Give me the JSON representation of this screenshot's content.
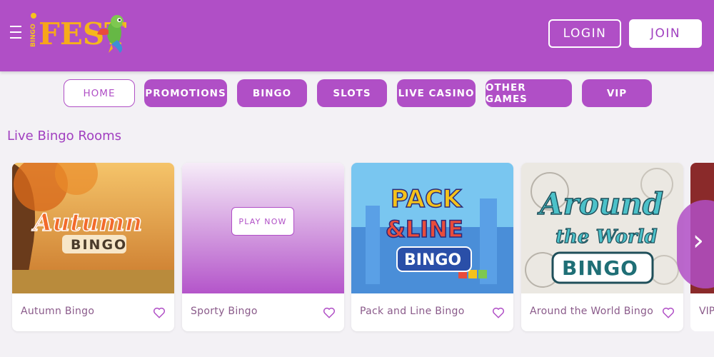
{
  "header": {
    "logo_small": "BINGO",
    "logo_text": "FEST",
    "login_label": "LOGIN",
    "join_label": "JOIN"
  },
  "nav": {
    "items": [
      {
        "label": "HOME",
        "active": true
      },
      {
        "label": "PROMOTIONS",
        "active": false
      },
      {
        "label": "BINGO",
        "active": false
      },
      {
        "label": "SLOTS",
        "active": false
      },
      {
        "label": "LIVE CASINO",
        "active": false
      },
      {
        "label": "OTHER GAMES",
        "active": false
      },
      {
        "label": "VIP",
        "active": false
      }
    ]
  },
  "section": {
    "title": "Live Bingo Rooms"
  },
  "rooms": [
    {
      "name": "Autumn Bingo",
      "art_title": "Autumn",
      "art_sub": "BINGO"
    },
    {
      "name": "Sporty Bingo",
      "play_label": "PLAY NOW"
    },
    {
      "name": "Pack and Line Bingo",
      "art_title": "PACK",
      "art_amp": "&LINE",
      "art_sub": "BINGO"
    },
    {
      "name": "Around the World Bingo",
      "art_title": "Around",
      "art_mid": "the World",
      "art_sub": "BINGO"
    },
    {
      "name": "VIP"
    }
  ],
  "colors": {
    "brand": "#b04fc6",
    "background": "#f3f1f5",
    "card_label": "#8a5a8a"
  }
}
